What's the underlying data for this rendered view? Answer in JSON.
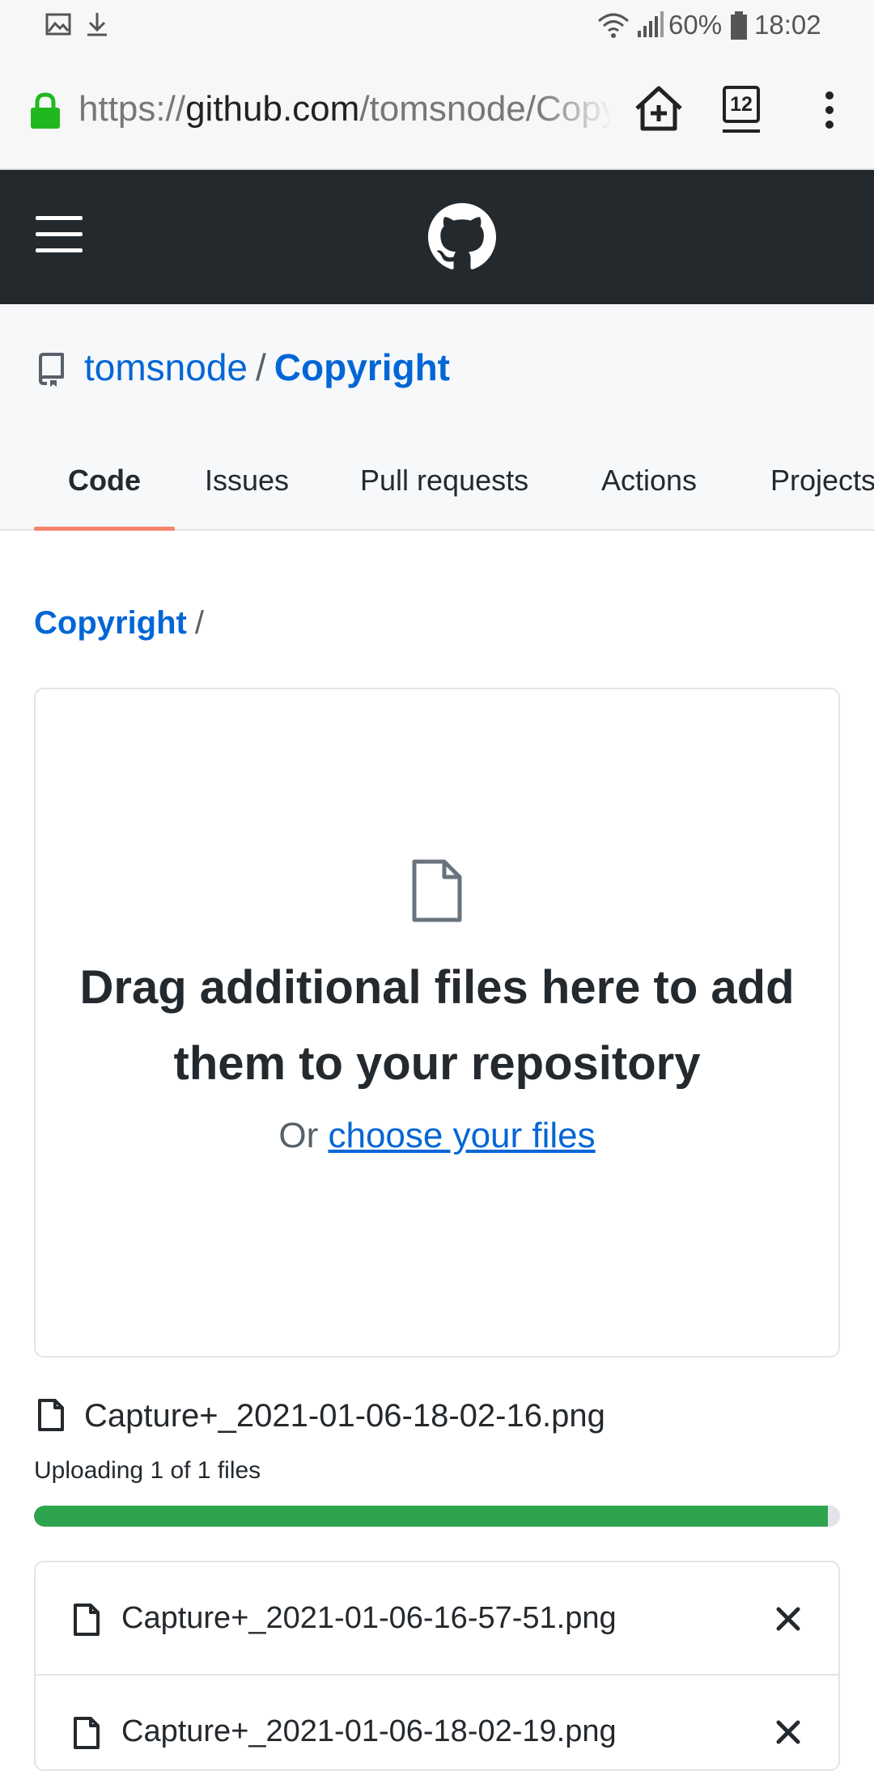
{
  "status_bar": {
    "battery_percent": "60%",
    "time": "18:02",
    "icons": [
      "image-icon",
      "download-icon",
      "wifi-icon",
      "signal-icon",
      "battery-icon"
    ]
  },
  "browser": {
    "url_scheme": "https://",
    "url_host": "github.com",
    "url_path": "/tomsnode/Copyright/upload",
    "tab_count": "12",
    "icons": [
      "lock-icon",
      "home-add-icon",
      "tabs-icon",
      "more-vert-icon"
    ]
  },
  "github_header": {
    "icons": [
      "hamburger-menu-icon",
      "github-octocat-icon"
    ]
  },
  "repo": {
    "owner": "tomsnode",
    "separator": "/",
    "name": "Copyright",
    "tabs": [
      {
        "label": "Code",
        "active": true
      },
      {
        "label": "Issues",
        "active": false
      },
      {
        "label": "Pull requests",
        "active": false
      },
      {
        "label": "Actions",
        "active": false
      },
      {
        "label": "Projects",
        "active": false
      }
    ]
  },
  "breadcrumb": {
    "root": "Copyright",
    "separator": "/"
  },
  "dropzone": {
    "title": "Drag additional files here to add them to your repository",
    "or_text": "Or",
    "choose_link": "choose your files"
  },
  "upload": {
    "current_file": "Capture+_2021-01-06-18-02-16.png",
    "status": "Uploading 1 of 1 files",
    "progress_fraction": 0.985
  },
  "files": [
    {
      "name": "Capture+_2021-01-06-16-57-51.png"
    },
    {
      "name": "Capture+_2021-01-06-18-02-19.png"
    }
  ],
  "colors": {
    "header_bg": "#24292e",
    "link_blue": "#0366d6",
    "progress_green": "#2ea44f",
    "active_tab_underline": "#f9826c"
  }
}
